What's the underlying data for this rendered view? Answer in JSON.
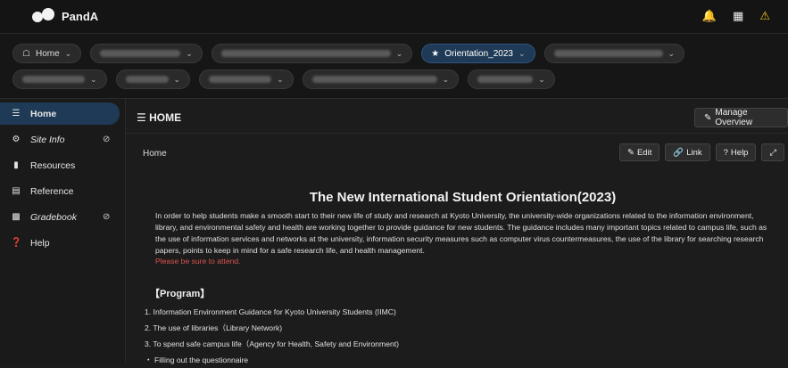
{
  "app": {
    "name": "PandA"
  },
  "sites": {
    "home_label": "Home",
    "active_label": "Orientation_2023",
    "row1_blur_widths": [
      90,
      130,
      190,
      120
    ],
    "row2_blur_widths": [
      70,
      48,
      70,
      140,
      62
    ]
  },
  "sidebar": {
    "items": [
      {
        "label": "Home"
      },
      {
        "label": "Site Info"
      },
      {
        "label": "Resources"
      },
      {
        "label": "Reference"
      },
      {
        "label": "Gradebook"
      },
      {
        "label": "Help"
      }
    ]
  },
  "main": {
    "title": "HOME",
    "manage_label": "Manage Overview",
    "breadcrumb": "Home",
    "tools": {
      "edit": "Edit",
      "link": "Link",
      "help": "Help"
    },
    "content_title": "The New International Student Orientation(2023)",
    "paragraph": "In order to help students make a smooth start to their new life of study and research at Kyoto University, the university-wide organizations related to the information environment, library, and environmental safety and health are working together to provide guidance for new students. The guidance includes many important topics related to campus life, such as the use of information services and networks at the university, information security measures such as computer virus countermeasures, the use of the library for searching research papers, points to keep in mind for a safe research life, and health management.",
    "attend_note": "Please be sure to attend.",
    "program_heading": "【Program】",
    "program_items": [
      "1. Information Environment Guidance for Kyoto University Students (IIMC)",
      "2. The use of libraries（Library Network)",
      "3. To spend safe campus life（Agency for Health, Safety and Environment)",
      "・ Filling out the questionnaire"
    ]
  },
  "colors": {
    "accent": "#1f3a56",
    "attend": "#d9534f",
    "warn": "#f0c419"
  }
}
